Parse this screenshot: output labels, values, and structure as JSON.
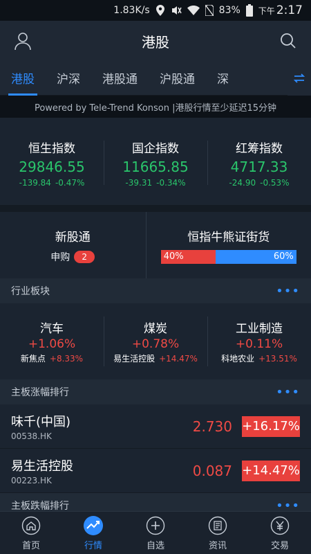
{
  "status": {
    "speed": "1.83K/s",
    "battery": "83%",
    "ampm": "下午",
    "time": "2:17"
  },
  "header": {
    "title": "港股"
  },
  "tabs": [
    "港股",
    "沪深",
    "港股通",
    "沪股通",
    "深"
  ],
  "powered": "Powered by Tele-Trend Konson |港股行情至少延迟15分钟",
  "indices": [
    {
      "name": "恒生指数",
      "value": "29846.55",
      "change": "-139.84",
      "pct": "-0.47%"
    },
    {
      "name": "国企指数",
      "value": "11665.85",
      "change": "-39.31",
      "pct": "-0.34%"
    },
    {
      "name": "红筹指数",
      "value": "4717.33",
      "change": "-24.90",
      "pct": "-0.53%"
    }
  ],
  "ipo": {
    "title": "新股通",
    "sub_label": "申购",
    "count": "2"
  },
  "bullbear": {
    "title": "恒指牛熊证街货",
    "bull_pct": "40%",
    "bear_pct": "60%",
    "bull_fraction": 0.4
  },
  "sectors_head": {
    "title": "行业板块",
    "more": "•••"
  },
  "sectors": [
    {
      "name": "汽车",
      "pct": "+1.06%",
      "leader": "新焦点",
      "leader_pct": "+8.33%"
    },
    {
      "name": "煤炭",
      "pct": "+0.78%",
      "leader": "易生活控股",
      "leader_pct": "+14.47%"
    },
    {
      "name": "工业制造",
      "pct": "+0.11%",
      "leader": "科地农业",
      "leader_pct": "+13.51%"
    }
  ],
  "gainers_head": {
    "title": "主板涨幅排行",
    "more": "•••"
  },
  "gainers": [
    {
      "name": "味千(中国)",
      "code": "00538.HK",
      "price": "2.730",
      "change": "+16.17%"
    },
    {
      "name": "易生活控股",
      "code": "00223.HK",
      "price": "0.087",
      "change": "+14.47%"
    }
  ],
  "losers_head": {
    "title": "主板跌幅排行",
    "more": "•••"
  },
  "nav": [
    {
      "label": "首页",
      "icon": "home-icon"
    },
    {
      "label": "行情",
      "icon": "market-chart-icon"
    },
    {
      "label": "自选",
      "icon": "add-watchlist-icon"
    },
    {
      "label": "资讯",
      "icon": "news-icon"
    },
    {
      "label": "交易",
      "icon": "trade-yen-icon"
    }
  ],
  "colors": {
    "accent": "#2f8cff",
    "up": "#ef4a45",
    "down": "#2ac56b",
    "background": "#1b2430"
  }
}
